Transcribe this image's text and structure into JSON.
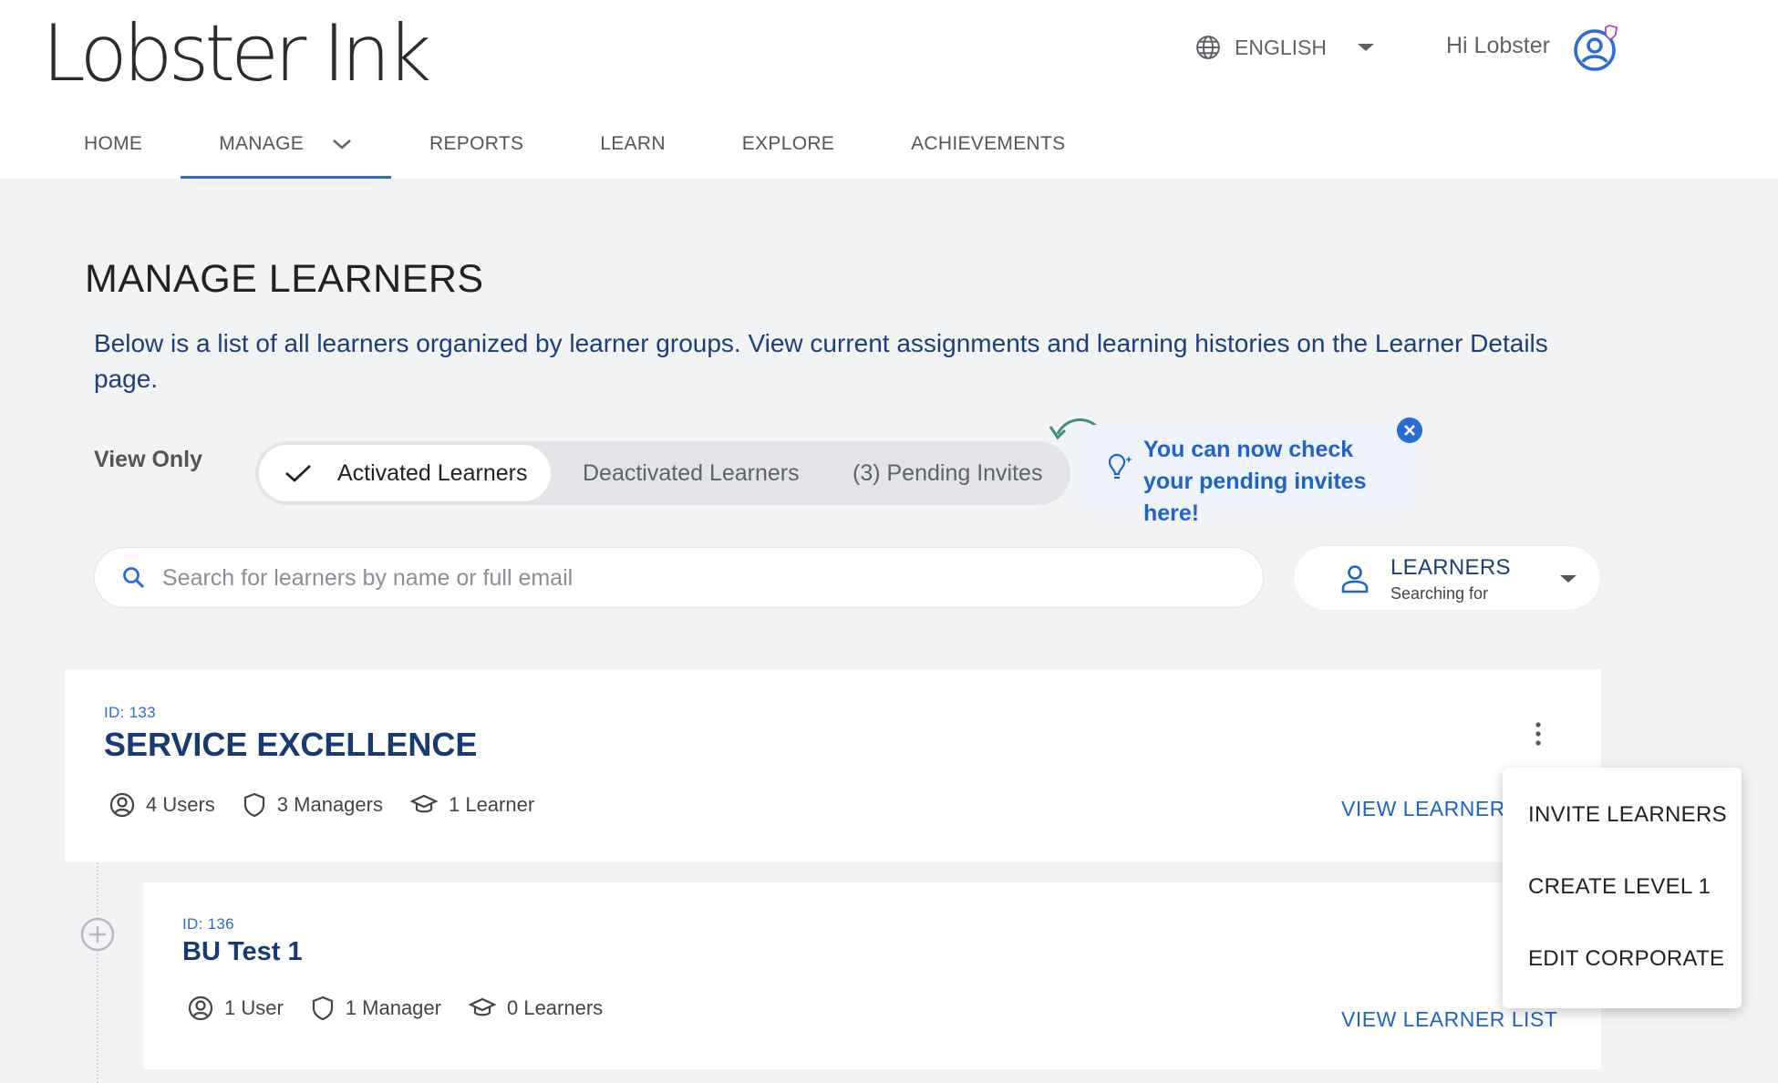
{
  "header": {
    "logo": "Lobster Ink",
    "language": "ENGLISH",
    "greeting": "Hi Lobster"
  },
  "nav": {
    "items": [
      {
        "label": "HOME"
      },
      {
        "label": "MANAGE"
      },
      {
        "label": "REPORTS"
      },
      {
        "label": "LEARN"
      },
      {
        "label": "EXPLORE"
      },
      {
        "label": "ACHIEVEMENTS"
      }
    ],
    "active": "MANAGE"
  },
  "page": {
    "title": "MANAGE LEARNERS",
    "intro": "Below is a list of all learners organized by learner groups. View current assignments and learning histories on the Learner Details page."
  },
  "view_filter": {
    "label": "View Only",
    "options": [
      {
        "label": "Activated Learners",
        "selected": true
      },
      {
        "label": "Deactivated Learners",
        "selected": false
      },
      {
        "label": "(3) Pending Invites",
        "selected": false
      }
    ]
  },
  "tip": {
    "text": "You can now check your pending invites here!"
  },
  "search": {
    "placeholder": "Search for learners by name or full email",
    "value": ""
  },
  "search_type": {
    "title": "LEARNERS",
    "subtitle": "Searching for"
  },
  "groups": [
    {
      "id_label": "ID: 133",
      "name": "SERVICE EXCELLENCE",
      "users": "4 Users",
      "managers": "3 Managers",
      "learners": "1 Learner",
      "link": "VIEW LEARNER LIST"
    },
    {
      "id_label": "ID: 136",
      "name": "BU Test 1",
      "users": "1 User",
      "managers": "1 Manager",
      "learners": "0 Learners",
      "link": "VIEW LEARNER LIST"
    }
  ],
  "context_menu": {
    "items": [
      {
        "label": "INVITE LEARNERS"
      },
      {
        "label": "CREATE LEVEL 1"
      },
      {
        "label": "EDIT CORPORATE"
      }
    ]
  },
  "colors": {
    "accent": "#2a6bd6",
    "heading_navy": "#163a72",
    "background": "#f2f3f5"
  }
}
